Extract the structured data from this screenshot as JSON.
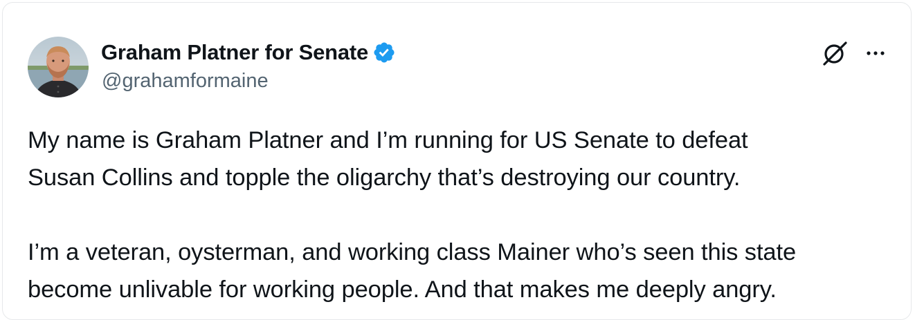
{
  "author": {
    "display_name": "Graham Platner for Senate",
    "handle": "@grahamformaine",
    "verified": true,
    "avatar_icon": "profile-photo"
  },
  "icons": {
    "verified": "verified-badge-icon",
    "grok": "grok-icon",
    "more": "more-options-icon"
  },
  "colors": {
    "text_primary": "#0f1419",
    "text_secondary": "#536471",
    "verified_blue": "#1d9bf0"
  },
  "tweet": {
    "paragraphs": [
      {
        "lines": [
          "My name is Graham Platner and I’m running for US Senate to defeat",
          "Susan Collins and topple the oligarchy that’s destroying our country."
        ]
      },
      {
        "lines": [
          "I’m a veteran, oysterman, and working class Mainer who’s seen this state",
          "become unlivable for working people. And that makes me deeply angry."
        ]
      }
    ]
  }
}
